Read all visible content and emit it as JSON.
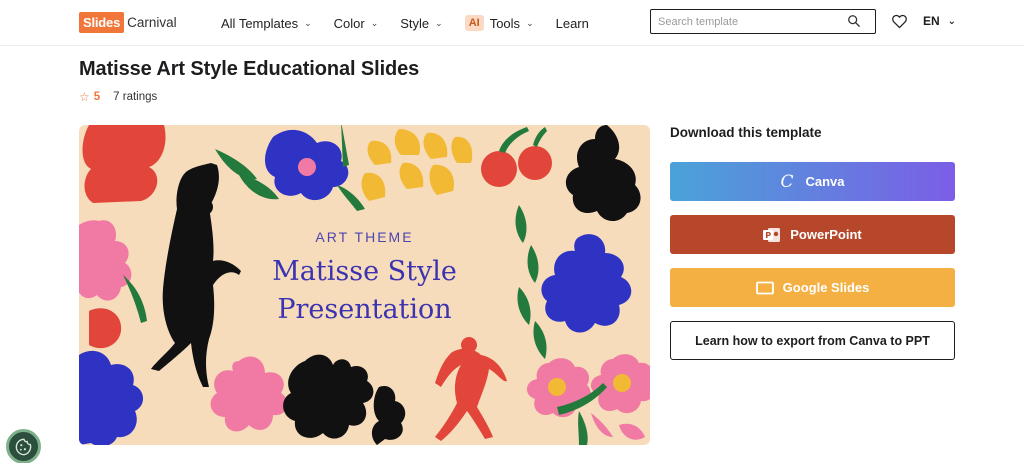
{
  "brand": {
    "logo_box": "Slides",
    "logo_text": "Carnival"
  },
  "nav": {
    "items": [
      {
        "label": "All Templates",
        "has_dropdown": true
      },
      {
        "label": "Color",
        "has_dropdown": true
      },
      {
        "label": "Style",
        "has_dropdown": true
      },
      {
        "badge": "AI",
        "label": "Tools",
        "has_dropdown": true
      },
      {
        "label": "Learn",
        "has_dropdown": false
      }
    ]
  },
  "search": {
    "placeholder": "Search template",
    "value": ""
  },
  "language": {
    "label": "EN"
  },
  "page": {
    "title": "Matisse Art Style Educational Slides",
    "rating_score": "5",
    "rating_count": "7 ratings"
  },
  "preview": {
    "subtitle": "ART THEME",
    "title_line1": "Matisse Style",
    "title_line2": "Presentation"
  },
  "download": {
    "heading": "Download this template",
    "canva_label": "Canva",
    "canva_icon": "C",
    "powerpoint_label": "PowerPoint",
    "google_slides_label": "Google Slides",
    "export_label": "Learn how to export from Canva to PPT"
  },
  "colors": {
    "brand_orange": "#f07639",
    "powerpoint": "#b7472a",
    "google_slides": "#f4b043",
    "canva_from": "#4aa3d8",
    "canva_to": "#7b5ee6",
    "slide_bg": "#f7dcbb",
    "slide_text": "#3b33b0"
  },
  "icons": {
    "search": "search-icon",
    "heart": "heart-icon",
    "cookie": "cookie-icon",
    "powerpoint": "powerpoint-icon",
    "google_slides": "google-slides-icon",
    "star": "star-icon"
  }
}
